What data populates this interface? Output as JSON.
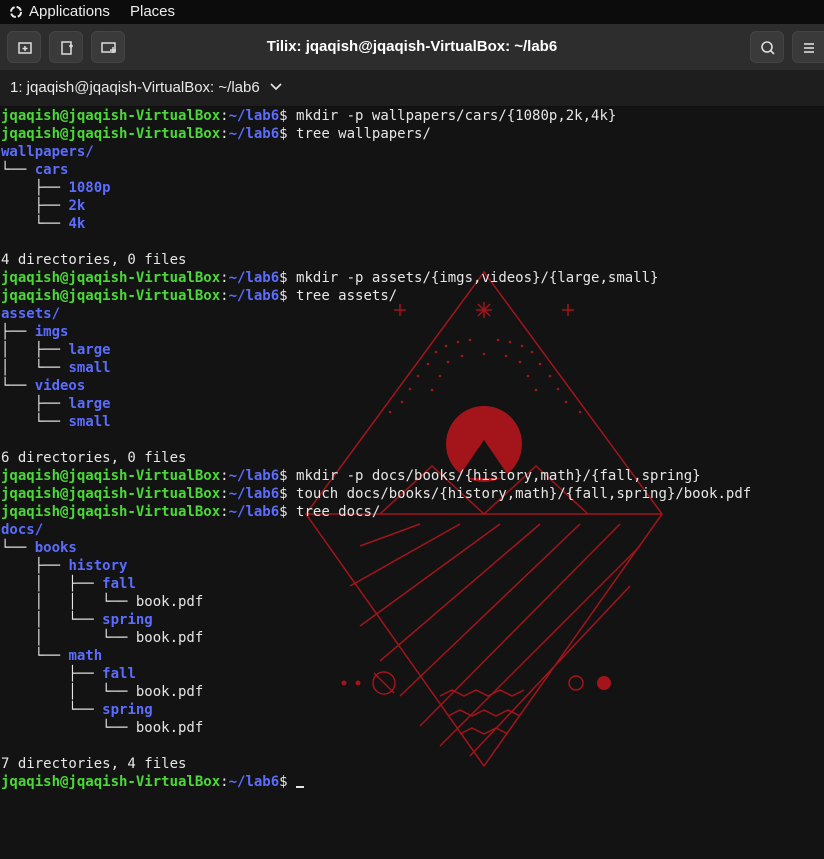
{
  "system_bar": {
    "applications_label": "Applications",
    "places_label": "Places"
  },
  "window": {
    "title": "Tilix: jqaqish@jqaqish-VirtualBox: ~/lab6",
    "tab_label": "1: jqaqish@jqaqish-VirtualBox: ~/lab6"
  },
  "prompt": {
    "user": "jqaqish@jqaqish-VirtualBox",
    "sep": ":",
    "path": "~/lab6",
    "symbol": "$ "
  },
  "terminal": {
    "lines": [
      {
        "type": "prompt",
        "cmd": "mkdir -p wallpapers/cars/{1080p,2k,4k}"
      },
      {
        "type": "prompt",
        "cmd": "tree wallpapers/"
      },
      {
        "type": "tree",
        "prefix": "",
        "name": "wallpapers/",
        "dir": true
      },
      {
        "type": "tree",
        "prefix": "└── ",
        "name": "cars",
        "dir": true
      },
      {
        "type": "tree",
        "prefix": "    ├── ",
        "name": "1080p",
        "dir": true
      },
      {
        "type": "tree",
        "prefix": "    ├── ",
        "name": "2k",
        "dir": true
      },
      {
        "type": "tree",
        "prefix": "    └── ",
        "name": "4k",
        "dir": true
      },
      {
        "type": "text",
        "text": ""
      },
      {
        "type": "text",
        "text": "4 directories, 0 files"
      },
      {
        "type": "prompt",
        "cmd": "mkdir -p assets/{imgs,videos}/{large,small}"
      },
      {
        "type": "prompt",
        "cmd": "tree assets/"
      },
      {
        "type": "tree",
        "prefix": "",
        "name": "assets/",
        "dir": true
      },
      {
        "type": "tree",
        "prefix": "├── ",
        "name": "imgs",
        "dir": true
      },
      {
        "type": "tree",
        "prefix": "│   ├── ",
        "name": "large",
        "dir": true
      },
      {
        "type": "tree",
        "prefix": "│   └── ",
        "name": "small",
        "dir": true
      },
      {
        "type": "tree",
        "prefix": "└── ",
        "name": "videos",
        "dir": true
      },
      {
        "type": "tree",
        "prefix": "    ├── ",
        "name": "large",
        "dir": true
      },
      {
        "type": "tree",
        "prefix": "    └── ",
        "name": "small",
        "dir": true
      },
      {
        "type": "text",
        "text": ""
      },
      {
        "type": "text",
        "text": "6 directories, 0 files"
      },
      {
        "type": "prompt",
        "cmd": "mkdir -p docs/books/{history,math}/{fall,spring}"
      },
      {
        "type": "prompt",
        "cmd": "touch docs/books/{history,math}/{fall,spring}/book.pdf"
      },
      {
        "type": "prompt",
        "cmd": "tree docs/"
      },
      {
        "type": "tree",
        "prefix": "",
        "name": "docs/",
        "dir": true
      },
      {
        "type": "tree",
        "prefix": "└── ",
        "name": "books",
        "dir": true
      },
      {
        "type": "tree",
        "prefix": "    ├── ",
        "name": "history",
        "dir": true
      },
      {
        "type": "tree",
        "prefix": "    │   ├── ",
        "name": "fall",
        "dir": true
      },
      {
        "type": "tree",
        "prefix": "    │   │   └── ",
        "name": "book.pdf",
        "dir": false
      },
      {
        "type": "tree",
        "prefix": "    │   └── ",
        "name": "spring",
        "dir": true
      },
      {
        "type": "tree",
        "prefix": "    │       └── ",
        "name": "book.pdf",
        "dir": false
      },
      {
        "type": "tree",
        "prefix": "    └── ",
        "name": "math",
        "dir": true
      },
      {
        "type": "tree",
        "prefix": "        ├── ",
        "name": "fall",
        "dir": true
      },
      {
        "type": "tree",
        "prefix": "        │   └── ",
        "name": "book.pdf",
        "dir": false
      },
      {
        "type": "tree",
        "prefix": "        └── ",
        "name": "spring",
        "dir": true
      },
      {
        "type": "tree",
        "prefix": "            └── ",
        "name": "book.pdf",
        "dir": false
      },
      {
        "type": "text",
        "text": ""
      },
      {
        "type": "text",
        "text": "7 directories, 4 files"
      },
      {
        "type": "prompt",
        "cmd": "",
        "cursor": true
      }
    ]
  },
  "colors": {
    "prompt_user": "#4bd838",
    "prompt_path": "#5b6cff",
    "directory": "#5b6cff",
    "wallpaper_accent": "#a3141b",
    "background": "#131313"
  },
  "icons": {
    "apps": "apps-icon",
    "add_terminal_right": "add-terminal-right-icon",
    "add_terminal_down": "add-terminal-down-icon",
    "new_window": "new-window-icon",
    "search": "search-icon",
    "menu": "menu-icon",
    "tab_dropdown": "chevron-down-icon"
  }
}
